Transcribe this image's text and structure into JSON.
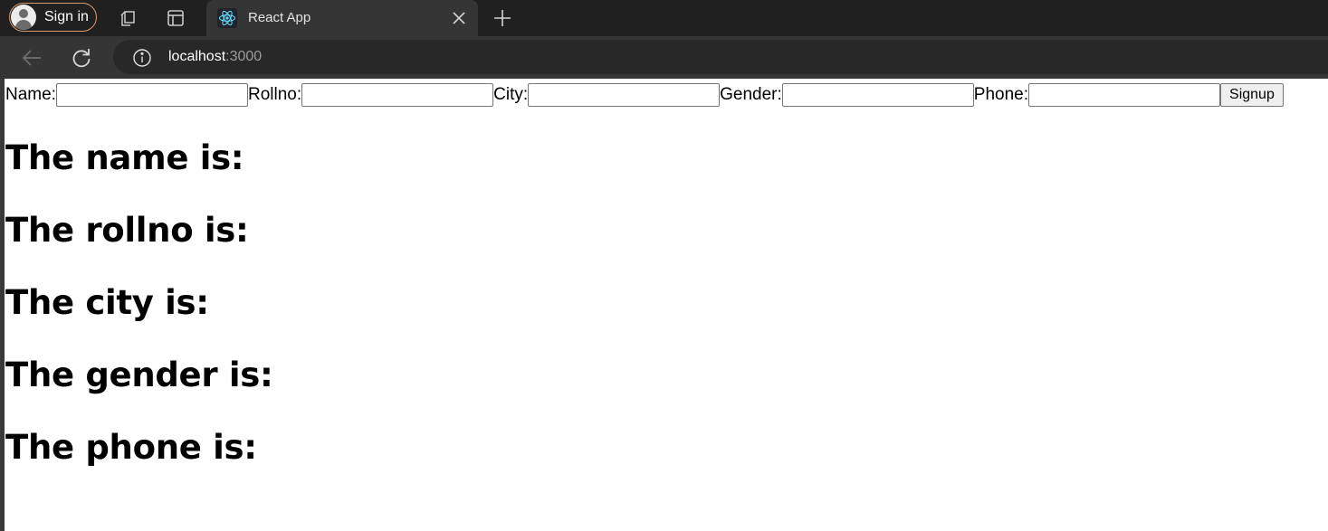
{
  "browser": {
    "profile_button_label": "Sign in",
    "tab_title": "React App",
    "url_host": "localhost",
    "url_port": ":3000"
  },
  "form": {
    "name_label": "Name:",
    "name_value": "",
    "rollno_label": "Rollno:",
    "rollno_value": "",
    "city_label": "City:",
    "city_value": "",
    "gender_label": "Gender:",
    "gender_value": "",
    "phone_label": "Phone:",
    "phone_value": "",
    "submit_label": "Signup"
  },
  "output": {
    "name_line": "The name is:",
    "rollno_line": "The rollno is:",
    "city_line": "The city is:",
    "gender_line": "The gender is:",
    "phone_line": "The phone is:"
  },
  "colors": {
    "chrome_dark": "#202020",
    "chrome_toolbar": "#353535",
    "profile_ring": "#d99a6c",
    "react_blue": "#61dafb"
  },
  "icons": [
    "user-avatar-icon",
    "workspaces-icon",
    "side-panel-icon",
    "react-favicon",
    "close-icon",
    "plus-icon",
    "back-arrow-icon",
    "reload-icon",
    "site-info-icon"
  ]
}
